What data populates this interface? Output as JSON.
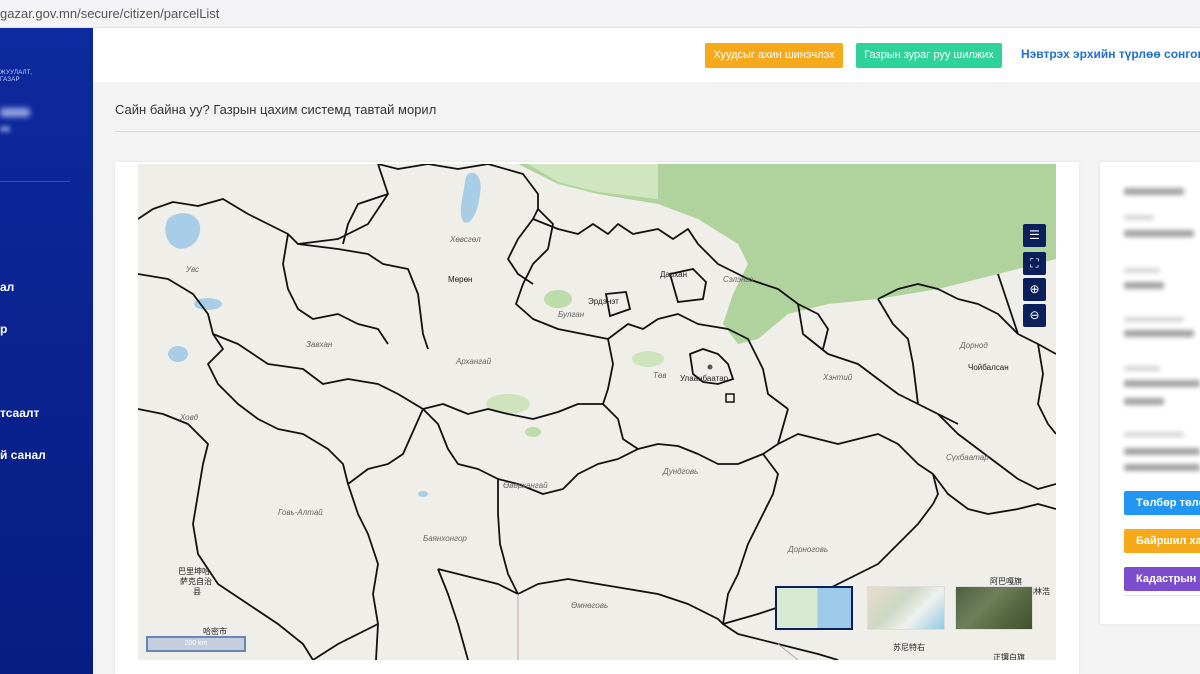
{
  "browser": {
    "url": "gazar.gov.mn/secure/citizen/parcelList"
  },
  "sidebar": {
    "logo_lines": [
      "ЖУУЛАЛТ,",
      "ГАЗАР"
    ],
    "menu_items": [
      {
        "label": "ал"
      },
      {
        "label": "р"
      },
      {
        "label": "тсаалт"
      },
      {
        "label": "й санал"
      }
    ]
  },
  "header": {
    "refresh_button": "Хуудсыг ахин шинэчлэх",
    "map_button": "Газрын зураг руу шилжих",
    "login_history_link": "Нэвтрэх эрхийн түрлөө сонгоно"
  },
  "main": {
    "greeting": "Сайн байна уу? Газрын цахим системд тавтай морил"
  },
  "map": {
    "scale_label": "200 km",
    "controls": [
      "layers-icon",
      "fullscreen-icon",
      "zoom-in-icon",
      "zoom-out-icon"
    ],
    "labels": {
      "uvs": "Увс",
      "khuvsgul": "Хөвсгөл",
      "murun": "Мөрөн",
      "darkhan": "Дархан",
      "selenge": "Сэлэнгэ",
      "erdenet": "Эрдэнэт",
      "bulgan": "Булган",
      "zavkhan": "Завхан",
      "arkhangai": "Архангай",
      "tuv": "Төв",
      "ulaanbaatar": "Улаанбаатар",
      "khentii": "Хэнтий",
      "dornod": "Дорнод",
      "choibalsan": "Чойбалсан",
      "khovd": "Ховд",
      "sukhbaatar": "Сүхбаатар",
      "ovorkhangai": "Өвөрхангай",
      "dundgovi": "Дундговь",
      "govi_altai": "Говь-Алтай",
      "bayankhongor": "Баянхонгор",
      "dornogovi": "Дорноговь",
      "omnogovi": "Өмнөговь",
      "cn1": "巴里坤哈",
      "cn2": "萨克自治",
      "cn3": "县",
      "cn4": "哈密市",
      "cn5": "阿巴嘎旗",
      "cn6": "苏尼特右",
      "cn7": "正镶白旗",
      "cn8": "阿巴嘎旗",
      "cn9": "锡林浩"
    },
    "colors": {
      "land": "#efeee9",
      "forest": "#a9cf95",
      "water": "#a8cde6",
      "border": "#111111"
    }
  },
  "info_panel": {
    "buttons": [
      {
        "label": "Төлбөр төлө",
        "color": "#2196f3"
      },
      {
        "label": "Байршил хар",
        "color": "#f6a91b"
      },
      {
        "label": "Кадастрын зу",
        "color": "#7c4dcc"
      }
    ]
  }
}
